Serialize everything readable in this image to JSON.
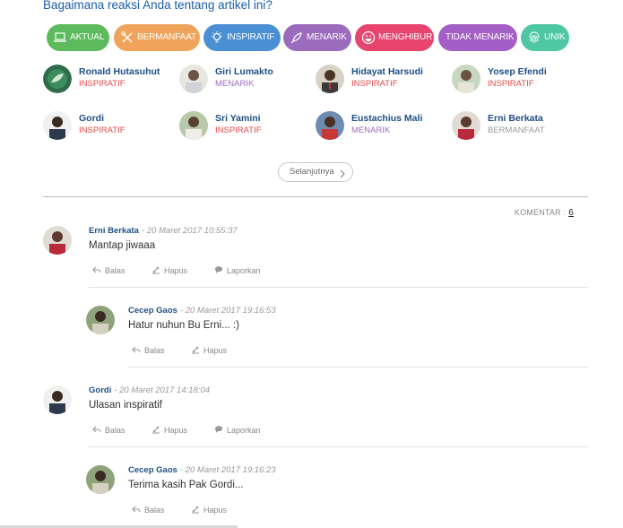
{
  "header": {
    "title": "Bagaimana reaksi Anda tentang artikel ini?"
  },
  "reactions": [
    {
      "label": "AKTUAL",
      "color": "#5dbb5d",
      "icon": "laptop-icon"
    },
    {
      "label": "BERMANFAAT",
      "color": "#f0a35a",
      "icon": "tools-icon"
    },
    {
      "label": "INSPIRATIF",
      "color": "#4a8fd4",
      "icon": "bulb-icon"
    },
    {
      "label": "MENARIK",
      "color": "#9b6bbd",
      "icon": "rocket-icon"
    },
    {
      "label": "MENGHIBUR",
      "color": "#e8456e",
      "icon": "laugh-icon"
    },
    {
      "label": "TIDAK MENARIK",
      "color": "#a35fc5",
      "icon": "none"
    },
    {
      "label": "UNIK",
      "color": "#4fc7a3",
      "icon": "fingerprint-icon"
    }
  ],
  "reactors": [
    {
      "name": "Ronald Hutasuhut",
      "reaction": "INSPIRATIF",
      "color": "#e04a4a"
    },
    {
      "name": "Giri Lumakto",
      "reaction": "MENARIK",
      "color": "#9b6bbd"
    },
    {
      "name": "Hidayat Harsudi",
      "reaction": "INSPIRATIF",
      "color": "#e04a4a"
    },
    {
      "name": "Yosep Efendi",
      "reaction": "INSPIRATIF",
      "color": "#e04a4a"
    },
    {
      "name": "Gordi",
      "reaction": "INSPIRATIF",
      "color": "#e04a4a"
    },
    {
      "name": "Sri Yamini",
      "reaction": "INSPIRATIF",
      "color": "#e04a4a"
    },
    {
      "name": "Eustachius Mali",
      "reaction": "MENARIK",
      "color": "#9b6bbd"
    },
    {
      "name": "Erni Berkata",
      "reaction": "BERMANFAAT",
      "color": "#999999"
    }
  ],
  "more_label": "Selanjutnya",
  "comment_count": {
    "label": "KOMENTAR :",
    "value": "6"
  },
  "comments": [
    {
      "name": "Erni Berkata",
      "date": "- 20 Maret 2017 10:55:37",
      "text": "Mantap jiwaaa",
      "actions": [
        "Balas",
        "Hapus",
        "Laporkan"
      ]
    },
    {
      "name": "Cecep Gaos",
      "date": "- 20 Maret 2017 19:16:53",
      "text": "Hatur nuhun Bu Erni... :)",
      "actions": [
        "Balas",
        "Hapus"
      ]
    },
    {
      "name": "Gordi",
      "date": "- 20 Maret 2017 14:18:04",
      "text": "Ulasan inspiratif",
      "actions": [
        "Balas",
        "Hapus",
        "Laporkan"
      ]
    },
    {
      "name": "Cecep Gaos",
      "date": "- 20 Maret 2017 19:16:23",
      "text": "Terima kasih Pak Gordi...",
      "actions": [
        "Balas",
        "Hapus"
      ]
    }
  ]
}
